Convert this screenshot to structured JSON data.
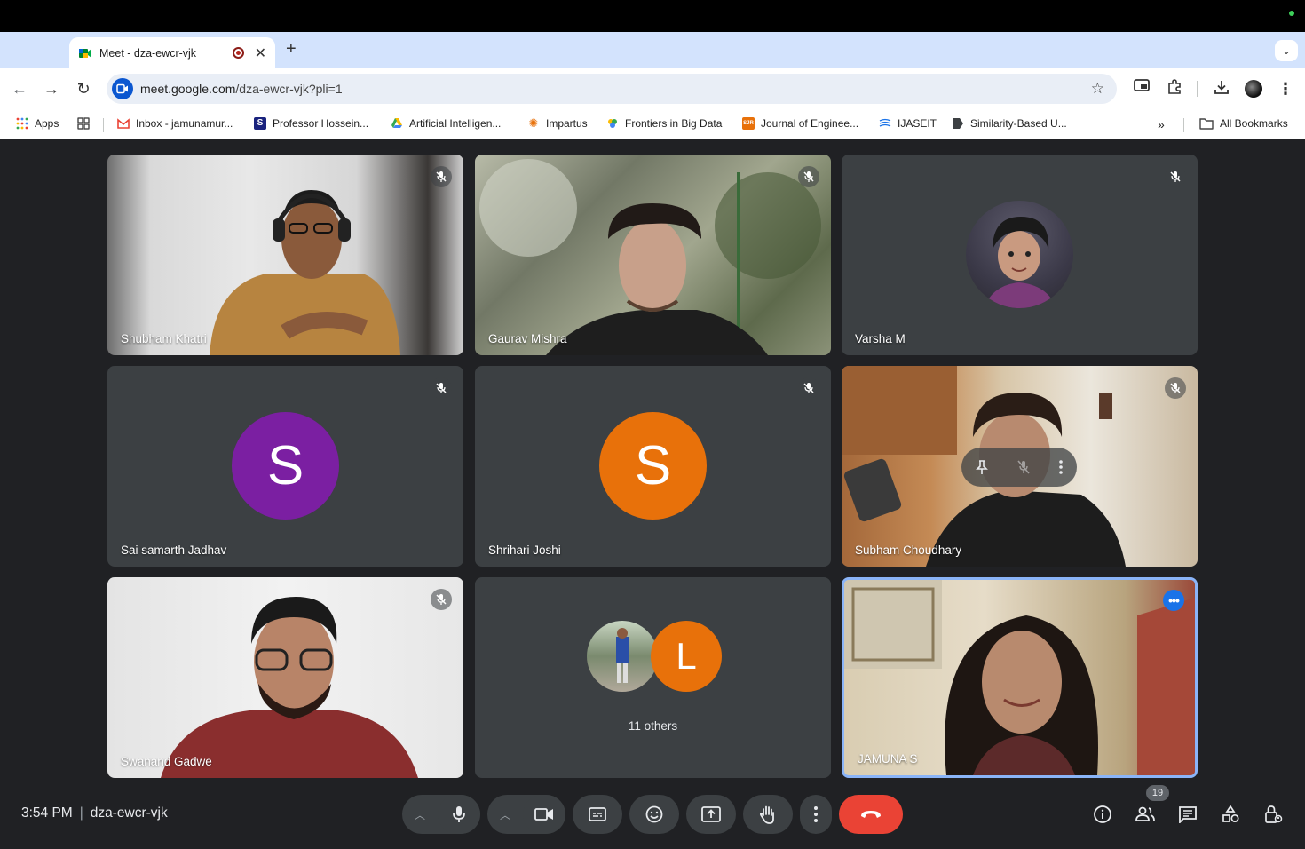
{
  "browser": {
    "tab_title": "Meet - dza-ewcr-vjk",
    "url_host": "meet.google.com",
    "url_path": "/dza-ewcr-vjk?pli=1",
    "bookmarks": [
      {
        "label": "Apps"
      },
      {
        "label": "Inbox - jamunamur..."
      },
      {
        "label": "Professor Hossein..."
      },
      {
        "label": "Artificial Intelligen..."
      },
      {
        "label": "Impartus"
      },
      {
        "label": "Frontiers in Big Data"
      },
      {
        "label": "Journal of Enginee..."
      },
      {
        "label": "IJASEIT"
      },
      {
        "label": "Similarity-Based U..."
      }
    ],
    "all_bookmarks": "All Bookmarks"
  },
  "meet": {
    "tiles": [
      {
        "name": "Shubham Khatri"
      },
      {
        "name": "Gaurav Mishra"
      },
      {
        "name": "Varsha M"
      },
      {
        "name": "Sai samarth Jadhav",
        "initial": "S",
        "color": "#7b1fa2"
      },
      {
        "name": "Shrihari Joshi",
        "initial": "S",
        "color": "#e8710a"
      },
      {
        "name": "Subham Choudhary"
      },
      {
        "name": "Swanand Gadwe"
      },
      {
        "name": "11 others",
        "initial": "L",
        "color": "#e8710a"
      },
      {
        "name": "JAMUNA S"
      }
    ],
    "time": "3:54 PM",
    "meeting_code": "dza-ewcr-vjk",
    "participant_count": "19",
    "colors": {
      "end_call": "#ea4335",
      "pinned_border": "#8ab4f8",
      "more_badge": "#1a73e8"
    }
  }
}
